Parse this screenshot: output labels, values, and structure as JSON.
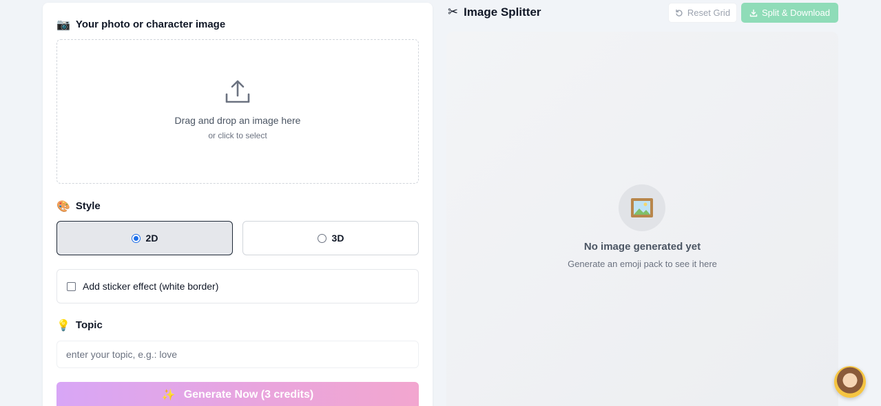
{
  "upload_section": {
    "emoji": "📷",
    "title": "Your photo or character image",
    "dropzone_main": "Drag and drop an image here",
    "dropzone_sub": "or click to select"
  },
  "style_section": {
    "emoji": "🎨",
    "title": "Style",
    "options": [
      {
        "label": "2D",
        "selected": true
      },
      {
        "label": "3D",
        "selected": false
      }
    ]
  },
  "sticker": {
    "label": "Add sticker effect (white border)",
    "checked": false
  },
  "topic_section": {
    "emoji": "💡",
    "title": "Topic",
    "placeholder": "enter your topic, e.g.: love",
    "value": ""
  },
  "generate_button": {
    "emoji": "✨",
    "label": "Generate Now (3 credits)"
  },
  "splitter": {
    "emoji": "✂",
    "title": "Image Splitter",
    "reset_label": "Reset Grid",
    "split_label": "Split & Download",
    "empty_title": "No image generated yet",
    "empty_sub": "Generate an emoji pack to see it here"
  },
  "colors": {
    "accent_blue": "#1d6ee8",
    "split_button": "#8fdcb8",
    "generate_gradient_start": "#d8a6f6",
    "generate_gradient_end": "#f2a6cf"
  }
}
